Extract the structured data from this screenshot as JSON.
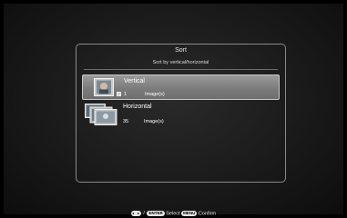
{
  "dialog": {
    "title": "Sort",
    "subtitle": "Sort by vertical/horizontal",
    "items": [
      {
        "label": "Vertical",
        "count": "1",
        "unit": "Image(s)",
        "selected": true,
        "icon": "portrait-photo-icon"
      },
      {
        "label": "Horizontal",
        "count": "35",
        "unit": "Image(s)",
        "selected": false,
        "icon": "landscape-photos-icon"
      }
    ]
  },
  "footer": {
    "nav_icon": "left-right-arrows-icon",
    "separator": "/",
    "enter_key": "ENTER",
    "select_label": "Select",
    "menu_key": "MENU",
    "confirm_label": "Confirm"
  }
}
